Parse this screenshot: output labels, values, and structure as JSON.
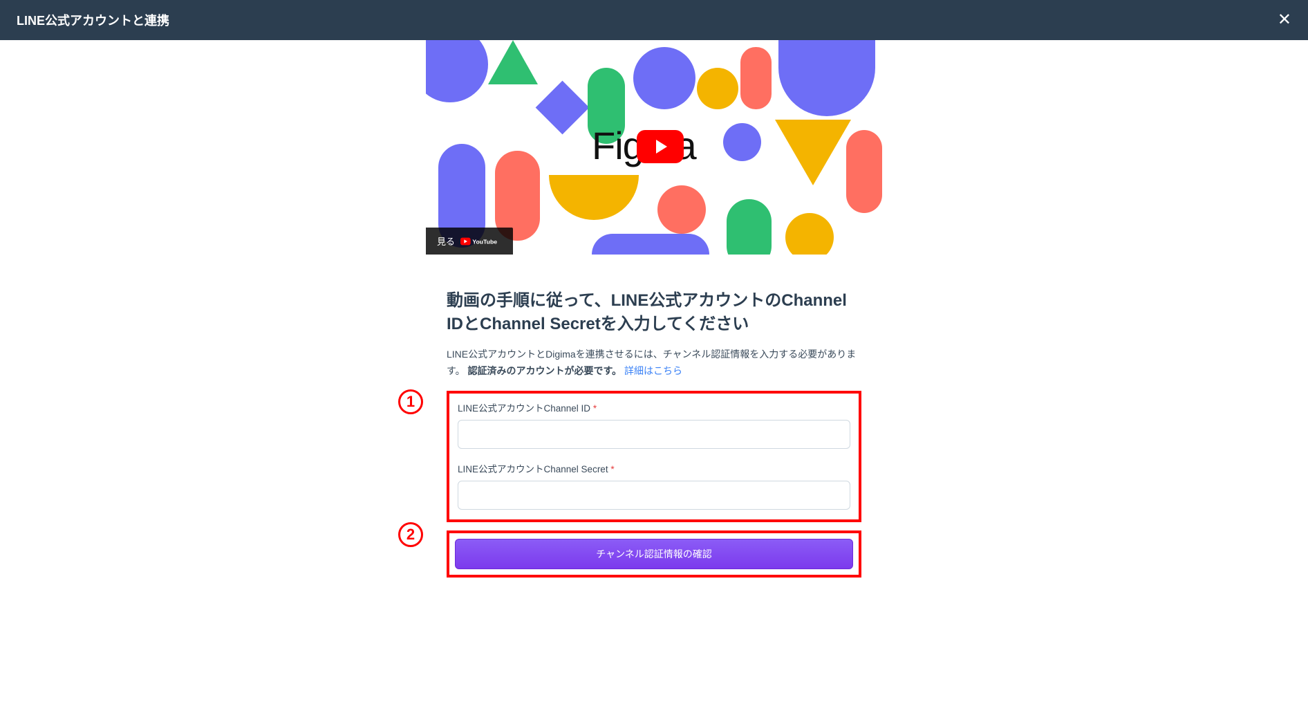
{
  "header": {
    "title": "LINE公式アカウントと連携"
  },
  "video": {
    "watch_label": "見る",
    "provider": "YouTube",
    "logo_text": "Figma"
  },
  "instructions": {
    "heading": "動画の手順に従って、LINE公式アカウントのChannel IDとChannel Secretを入力してください",
    "body_part1": "LINE公式アカウントとDigimaを連携させるには、チャンネル認証情報を入力する必要があります。",
    "body_strong": "認証済みのアカウントが必要です。",
    "link_text": "詳細はこちら"
  },
  "markers": {
    "one": "1",
    "two": "2"
  },
  "form": {
    "channel_id": {
      "label": "LINE公式アカウントChannel ID",
      "required_mark": "*",
      "value": ""
    },
    "channel_secret": {
      "label": "LINE公式アカウントChannel Secret",
      "required_mark": "*",
      "value": ""
    },
    "submit_label": "チャンネル認証情報の確認"
  },
  "colors": {
    "header_bg": "#2c3e50",
    "highlight": "#ff0000",
    "button_gradient_start": "#8b5cf6",
    "button_gradient_end": "#7c3aed",
    "link": "#3b82f6"
  }
}
